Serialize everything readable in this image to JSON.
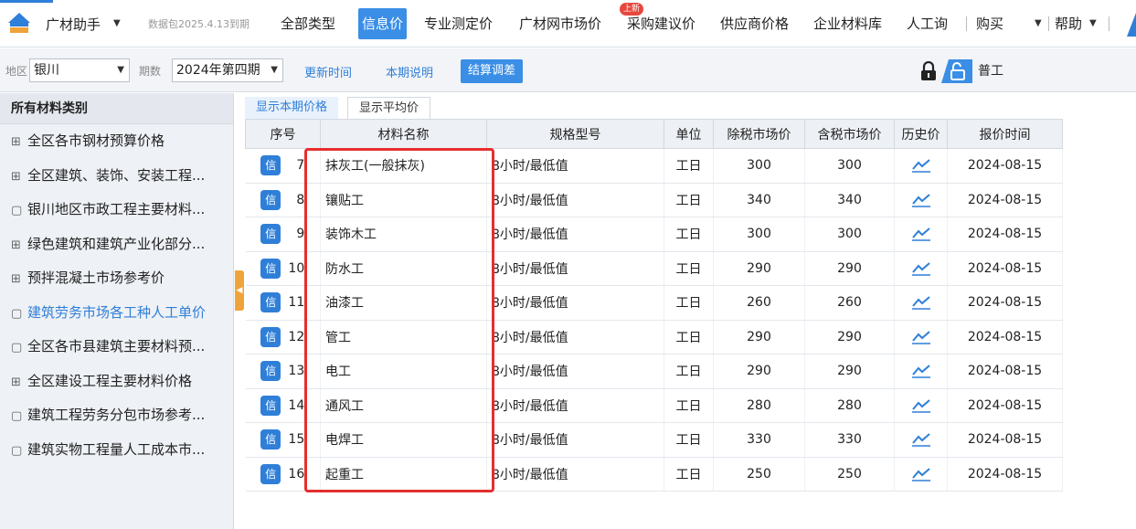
{
  "topnav": {
    "app_title": "广材助手",
    "data_package": "数据包2025.4.13到期",
    "items": [
      {
        "label": "全部类型"
      },
      {
        "label": "信息价"
      },
      {
        "label": "专业测定价"
      },
      {
        "label": "广材网市场价"
      },
      {
        "label": "采购建议价"
      },
      {
        "label": "供应商价格"
      },
      {
        "label": "企业材料库"
      },
      {
        "label": "人工询"
      }
    ],
    "new_badge": "上新",
    "buy_label": "购买",
    "help_label": "帮助",
    "colors": {
      "accent": "#2f7fd8",
      "active_tab": "#3a8ee6",
      "badge": "#e6483d",
      "highlight": "#e62e2e"
    }
  },
  "filters": {
    "region_label": "地区",
    "region_value": "银川",
    "period_label": "期数",
    "period_value": "2024年第四期",
    "update_time_link": "更新时间",
    "period_note_link": "本期说明",
    "settlement_button": "结算调差",
    "search_value": "普工"
  },
  "sidebar": {
    "header": "所有材料类别",
    "items": [
      {
        "icon": "⊞",
        "label": "全区各市钢材预算价格"
      },
      {
        "icon": "⊞",
        "label": "全区建筑、装饰、安装工程..."
      },
      {
        "icon": "▢",
        "label": "银川地区市政工程主要材料..."
      },
      {
        "icon": "⊞",
        "label": "绿色建筑和建筑产业化部分..."
      },
      {
        "icon": "⊞",
        "label": "预拌混凝土市场参考价"
      },
      {
        "icon": "▢",
        "label": "建筑劳务市场各工种人工单价"
      },
      {
        "icon": "▢",
        "label": "全区各市县建筑主要材料预..."
      },
      {
        "icon": "⊞",
        "label": "全区建设工程主要材料价格"
      },
      {
        "icon": "▢",
        "label": "建筑工程劳务分包市场参考..."
      },
      {
        "icon": "▢",
        "label": "建筑实物工程量人工成本市..."
      }
    ]
  },
  "tabs": {
    "current": "显示本期价格",
    "average": "显示平均价"
  },
  "table": {
    "headers": [
      "序号",
      "材料名称",
      "规格型号",
      "单位",
      "除税市场价",
      "含税市场价",
      "历史价",
      "报价时间"
    ],
    "badge": "信",
    "rows": [
      {
        "seq": "7",
        "name": "抹灰工(一般抹灰)",
        "spec": "8小时/最低值",
        "unit": "工日",
        "ex_tax": "300",
        "inc_tax": "300",
        "date": "2024-08-15"
      },
      {
        "seq": "8",
        "name": "镶贴工",
        "spec": "8小时/最低值",
        "unit": "工日",
        "ex_tax": "340",
        "inc_tax": "340",
        "date": "2024-08-15"
      },
      {
        "seq": "9",
        "name": "装饰木工",
        "spec": "8小时/最低值",
        "unit": "工日",
        "ex_tax": "300",
        "inc_tax": "300",
        "date": "2024-08-15"
      },
      {
        "seq": "10",
        "name": "防水工",
        "spec": "8小时/最低值",
        "unit": "工日",
        "ex_tax": "290",
        "inc_tax": "290",
        "date": "2024-08-15"
      },
      {
        "seq": "11",
        "name": "油漆工",
        "spec": "8小时/最低值",
        "unit": "工日",
        "ex_tax": "260",
        "inc_tax": "260",
        "date": "2024-08-15"
      },
      {
        "seq": "12",
        "name": "管工",
        "spec": "8小时/最低值",
        "unit": "工日",
        "ex_tax": "290",
        "inc_tax": "290",
        "date": "2024-08-15"
      },
      {
        "seq": "13",
        "name": "电工",
        "spec": "8小时/最低值",
        "unit": "工日",
        "ex_tax": "290",
        "inc_tax": "290",
        "date": "2024-08-15"
      },
      {
        "seq": "14",
        "name": "通风工",
        "spec": "8小时/最低值",
        "unit": "工日",
        "ex_tax": "280",
        "inc_tax": "280",
        "date": "2024-08-15"
      },
      {
        "seq": "15",
        "name": "电焊工",
        "spec": "8小时/最低值",
        "unit": "工日",
        "ex_tax": "330",
        "inc_tax": "330",
        "date": "2024-08-15"
      },
      {
        "seq": "16",
        "name": "起重工",
        "spec": "8小时/最低值",
        "unit": "工日",
        "ex_tax": "250",
        "inc_tax": "250",
        "date": "2024-08-15"
      }
    ]
  }
}
